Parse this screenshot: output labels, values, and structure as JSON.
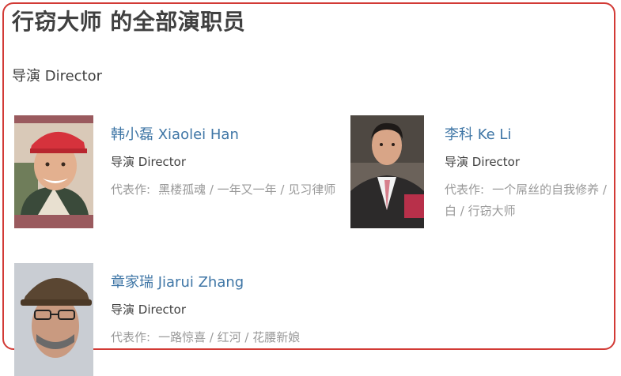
{
  "title": "行窃大师 的全部演职员",
  "section": "导演 Director",
  "people": [
    {
      "name": "韩小磊 Xiaolei Han",
      "role": "导演 Director",
      "works_label": "代表作:",
      "works": "黑楼孤魂 / 一年又一年 / 见习律师"
    },
    {
      "name": "李科 Ke Li",
      "role": "导演 Director",
      "works_label": "代表作:",
      "works": "一个屌丝的自我修养 / 白 / 行窃大师"
    },
    {
      "name": "章家瑞 Jiarui Zhang",
      "role": "导演 Director",
      "works_label": "代表作:",
      "works": "一路惊喜 / 红河 / 花腰新娘"
    }
  ]
}
